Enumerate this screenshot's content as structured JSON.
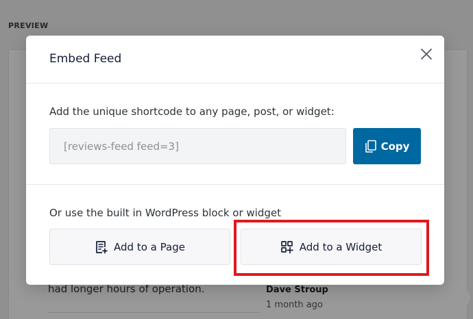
{
  "background": {
    "preview_label": "PREVIEW",
    "review_text": "had longer hours of operation.",
    "review_author": "Dave Stroup",
    "review_time": "1 month ago"
  },
  "modal": {
    "title": "Embed Feed",
    "close_icon": "close-icon",
    "shortcode_label": "Add the unique shortcode to any page, post, or widget:",
    "shortcode_value": "[reviews-feed feed=3]",
    "copy_label": "Copy",
    "copy_icon": "copy-icon",
    "alt_label": "Or use the built in WordPress block or widget",
    "add_page_label": "Add to a Page",
    "add_page_icon": "page-add-icon",
    "add_widget_label": "Add to a Widget",
    "add_widget_icon": "widget-add-icon"
  },
  "colors": {
    "primary_button": "#0068a0",
    "highlight": "#e0191d",
    "text_dark": "#141b38"
  }
}
